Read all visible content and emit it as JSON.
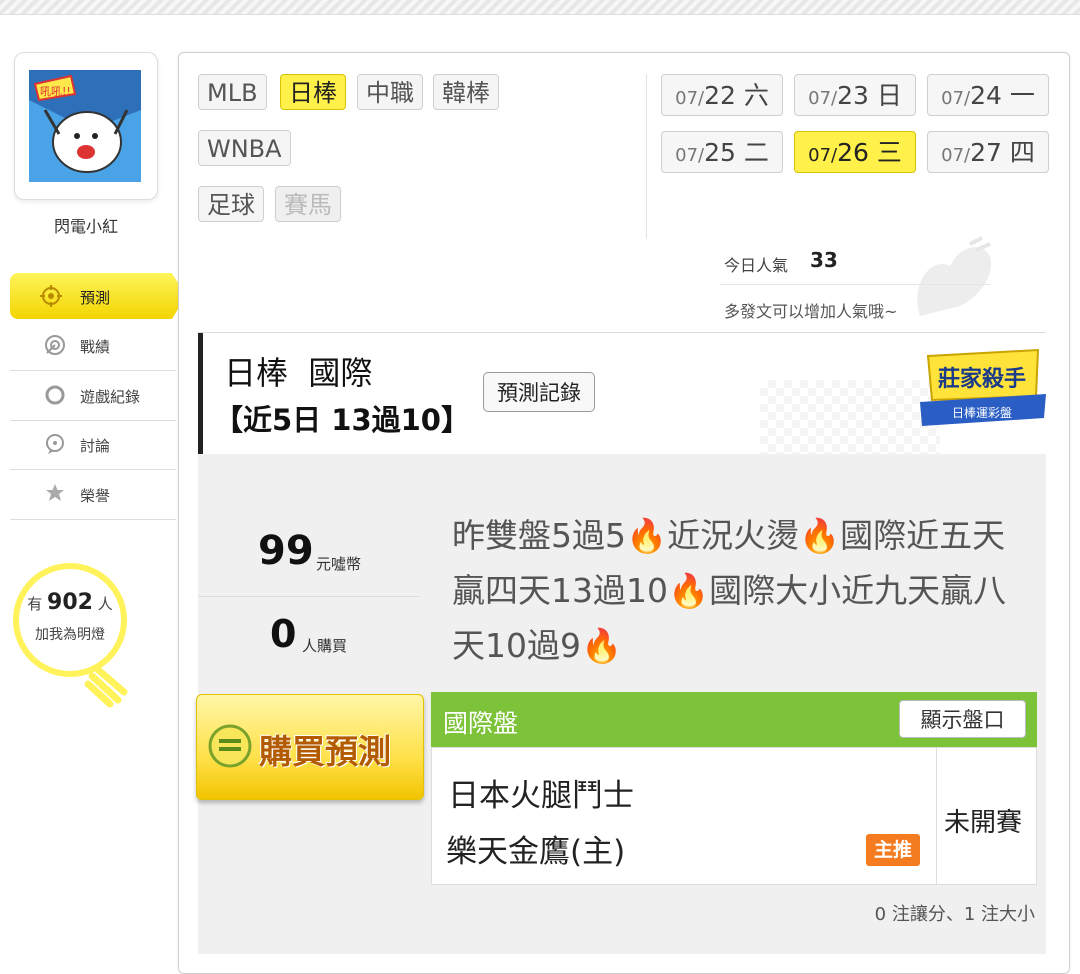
{
  "user": {
    "name": "閃電小紅",
    "avatar_caption": "吼吼!!"
  },
  "menu": {
    "active": {
      "label": "預測",
      "icon": "target-icon"
    },
    "items": [
      {
        "label": "戰績",
        "icon": "dart-icon"
      },
      {
        "label": "遊戲紀錄",
        "icon": "circle-icon"
      },
      {
        "label": "討論",
        "icon": "chat-icon"
      },
      {
        "label": "榮譽",
        "icon": "medal-icon"
      }
    ]
  },
  "followers": {
    "prefix": "有",
    "count": "902",
    "suffix": "人",
    "caption": "加我為明燈"
  },
  "sports": [
    {
      "label": "MLB",
      "state": "normal"
    },
    {
      "label": "日棒",
      "state": "active"
    },
    {
      "label": "中職",
      "state": "normal"
    },
    {
      "label": "韓棒",
      "state": "normal"
    },
    {
      "label": "WNBA",
      "state": "normal"
    },
    {
      "label": "足球",
      "state": "normal"
    },
    {
      "label": "賽馬",
      "state": "disabled"
    }
  ],
  "dates": [
    {
      "md": "07/",
      "d": "22 六",
      "active": false
    },
    {
      "md": "07/",
      "d": "23 日",
      "active": false
    },
    {
      "md": "07/",
      "d": "24 一",
      "active": false
    },
    {
      "md": "07/",
      "d": "25 二",
      "active": false
    },
    {
      "md": "07/",
      "d": "26 三",
      "active": true
    },
    {
      "md": "07/",
      "d": "27 四",
      "active": false
    }
  ],
  "popularity": {
    "label": "今日人氣",
    "value": "33",
    "tip": "多發文可以增加人氣哦~"
  },
  "prediction": {
    "title": "日棒  國際",
    "record": "【近5日 13過10】",
    "history_button": "預測記錄",
    "badge_title": "莊家殺手",
    "badge_sub": "日棒運彩盤"
  },
  "price": {
    "coins": "99",
    "coin_unit": "元噓幣",
    "buyers": "0",
    "buyer_unit": "人購買"
  },
  "description": "昨雙盤5過5🔥近況火燙🔥國際近五天贏四天13過10🔥國際大小近九天贏八天10過9🔥",
  "buy_button": "購買預測",
  "market": {
    "title": "國際盤",
    "show_button": "顯示盤口",
    "team_away": "日本火腿鬥士",
    "team_home": "樂天金鷹(主)",
    "pick_tag": "主推",
    "status": "未開賽"
  },
  "summary": "0 注讓分、1 注大小",
  "colors": {
    "accent_yellow": "#fff04a",
    "market_green": "#7cc33a",
    "pick_orange": "#f47b20"
  }
}
